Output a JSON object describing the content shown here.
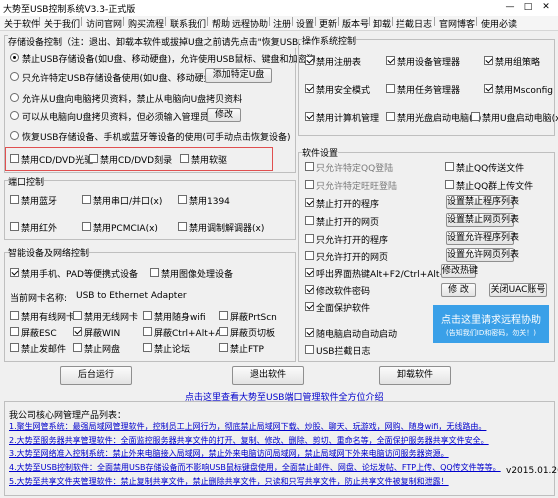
{
  "window": {
    "title": "大势至USB控制系统V3.3-正式版",
    "min": "—",
    "max": "□",
    "close": "✕"
  },
  "menu": [
    "关于软件",
    "关于我们",
    "访问官网",
    "购买流程",
    "联系我们",
    "帮助",
    "远程协助",
    "注册",
    "设置",
    "更新",
    "版本号",
    "卸载",
    "拦截日志",
    "官网博客",
    "使用必读"
  ],
  "storage": {
    "title": "存储设备控制（注：退出、卸载本软件或拔掉U盘之前请先点击\"恢复USB......\"）",
    "opt1": "禁止USB存储设备(如U盘、移动硬盘)，允许使用USB鼠标、键盘和加密狗",
    "opt2": "只允许特定USB存储设备使用(如U盘、移动硬盘)",
    "opt2_btn": "添加特定U盘",
    "opt3": "允许从U盘向电脑拷贝资料，禁止从电脑向U盘拷贝资料",
    "opt4": "可以从电脑向U盘拷贝资料，但必须输入管理员密码",
    "opt4_btn": "修改",
    "opt5": "恢复USB存储设备、手机或蓝牙等设备的使用(可手动点击恢复设备)",
    "cd_read": "禁用CD/DVD光驱",
    "cd_burn": "禁用CD/DVD刻录",
    "floppy": "禁用软驱"
  },
  "port": {
    "title": "端口控制",
    "items": [
      "禁用蓝牙",
      "禁用串口/并口(x)",
      "禁用1394",
      "禁用红外",
      "禁用PCMCIA(x)",
      "禁用调制解调器(x)"
    ]
  },
  "smart": {
    "title": "智能设备及网络控制",
    "phone": "禁用手机、PAD等便携式设备",
    "image": "禁用图像处理设备",
    "nic_label": "当前网卡名称:",
    "nic_value": "USB to Ethernet Adapter",
    "net_items": [
      "禁用有线网卡",
      "禁用无线网卡",
      "禁用随身wifi",
      "屏蔽PrtScn",
      "屏蔽ESC",
      "屏蔽WIN",
      "屏蔽Ctrl+Alt+A",
      "屏蔽页切板",
      "禁止发邮件",
      "禁止网盘",
      "禁止论坛",
      "禁止FTP"
    ]
  },
  "os": {
    "title": "操作系统控制",
    "items": [
      "禁用注册表",
      "禁用设备管理器",
      "禁用组策略",
      "禁用安全模式",
      "禁用任务管理器",
      "禁用Msconfig",
      "禁用计算机管理",
      "禁用光盘启动电脑(x)",
      "禁用U盘启动电脑(x)"
    ]
  },
  "software": {
    "title": "软件设置",
    "rows": [
      {
        "label": "只允许特定QQ登陆",
        "gray": true,
        "right": "禁止QQ传送文件",
        "rightType": "check"
      },
      {
        "label": "只允许特定旺旺登陆",
        "gray": true,
        "right": "禁止QQ群上传文件",
        "rightType": "check"
      },
      {
        "label": "禁止打开的程序",
        "gray": false,
        "right": "设置禁止程序列表",
        "rightType": "button"
      },
      {
        "label": "禁止打开的网页",
        "gray": false,
        "right": "设置禁止网页列表",
        "rightType": "button"
      },
      {
        "label": "只允许打开的程序",
        "gray": false,
        "right": "设置允许程序列表",
        "rightType": "button"
      },
      {
        "label": "只允许打开的网页",
        "gray": false,
        "right": "设置允许网页列表",
        "rightType": "button"
      }
    ],
    "hotkey_label": "呼出界面热键Alt+F2/Ctrl+Alt+1",
    "hotkey_btn": "修改热键",
    "pwd_label": "修改软件密码",
    "pwd_btn": "修 改",
    "uac_btn": "关闭UAC账号",
    "protect": "全面保护软件",
    "autostart": "随电脑启动自动启动",
    "usblog": "USB拦截日志",
    "remote_line1": "点击这里请求远程协助",
    "remote_line2": "(告知我们ID和密码，勿关！)"
  },
  "actions": {
    "bg": "后台运行",
    "exit": "退出软件",
    "uninstall": "卸载软件"
  },
  "link_main": "点击这里查看大势至USB端口管理软件全方位介绍",
  "products_title": "我公司核心网管理产品列表：",
  "products": [
    "1.聚生网管系统：最强局域网管理软件，控制员工上网行为，彻底禁止局域网下载、炒股、聊天、玩游戏，网购、随身wifi，无线路由。",
    "2.大势至服务器共享管理软件：全面监控服务器共享文件的打开、复制、修改、删除、剪切、重命名等，全面保护服务器共享文件安全。",
    "3.大势至网络准入控制系统：禁止外来电脑接入局域网，禁止外来电脑访问局域网，禁止局域网下外来电脑访问服务器资源。",
    "4.大势至USB控制软件：全面禁用USB存储设备而不影响USB鼠标键盘使用，全面禁止邮件、网盘、论坛发帖、FTP上传、QQ传文件等等。",
    "5.大势至共享文件夹管理软件：禁止复制共享文件，禁止删除共享文件，只读和只写共享文件，防止共享文件被复制和泄露！"
  ],
  "version": "v2015.01.26"
}
